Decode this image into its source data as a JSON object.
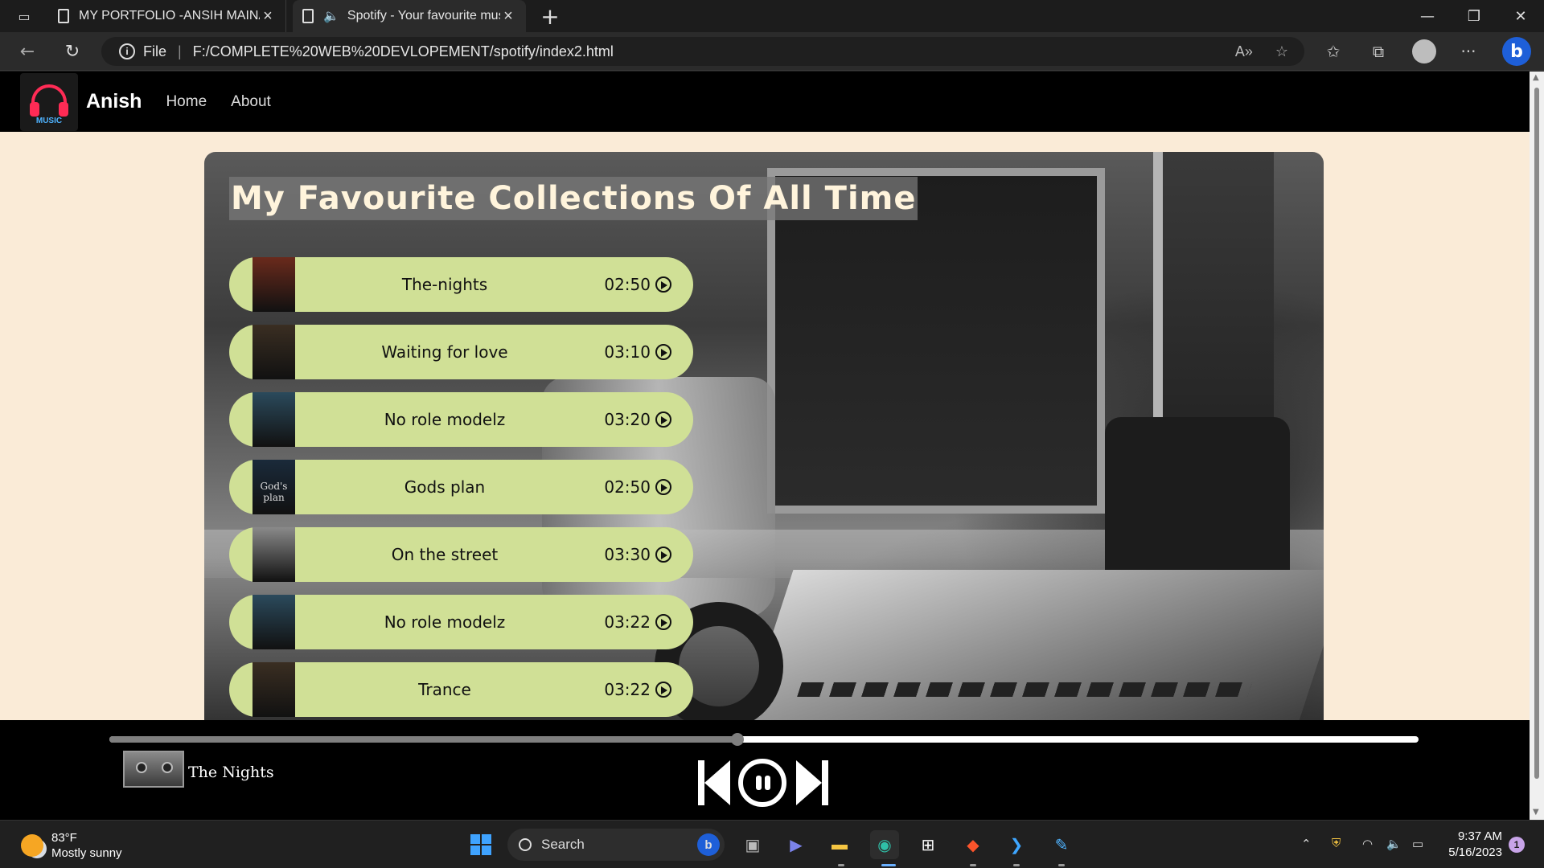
{
  "browser": {
    "tabs": [
      {
        "title": "MY PORTFOLIO -ANSIH MAINALI",
        "active": false
      },
      {
        "title": "Spotify - Your favourite music",
        "active": true,
        "playing_audio": true
      }
    ],
    "address": {
      "scheme_label": "File",
      "url": "F:/COMPLETE%20WEB%20DEVLOPEMENT/spotify/index2.html"
    }
  },
  "site": {
    "logo_text": "MUSIC",
    "brand": "Anish",
    "nav": [
      {
        "label": "Home"
      },
      {
        "label": "About"
      }
    ],
    "heading": "My Favourite Collections Of All Time",
    "songs": [
      {
        "name": "The-nights",
        "duration": "02:50",
        "cover_color": "#6a2a1c"
      },
      {
        "name": "Waiting for love",
        "duration": "03:10",
        "cover_color": "#3a2e22"
      },
      {
        "name": "No role modelz",
        "duration": "03:20",
        "cover_color": "#2b4a5c"
      },
      {
        "name": "Gods plan",
        "duration": "02:50",
        "cover_color": "#1a2a3a",
        "cover_text": "God's plan"
      },
      {
        "name": "On the street",
        "duration": "03:30",
        "cover_color": "#8a8a8a"
      },
      {
        "name": "No role modelz",
        "duration": "03:22",
        "cover_color": "#2b4a5c"
      },
      {
        "name": "Trance",
        "duration": "03:22",
        "cover_color": "#3a2e22"
      }
    ],
    "player": {
      "now_playing": "The Nights",
      "progress": 0.48
    }
  },
  "taskbar": {
    "weather_temp": "83°F",
    "weather_desc": "Mostly sunny",
    "search_placeholder": "Search",
    "time": "9:37 AM",
    "date": "5/16/2023",
    "notification_count": "1"
  }
}
